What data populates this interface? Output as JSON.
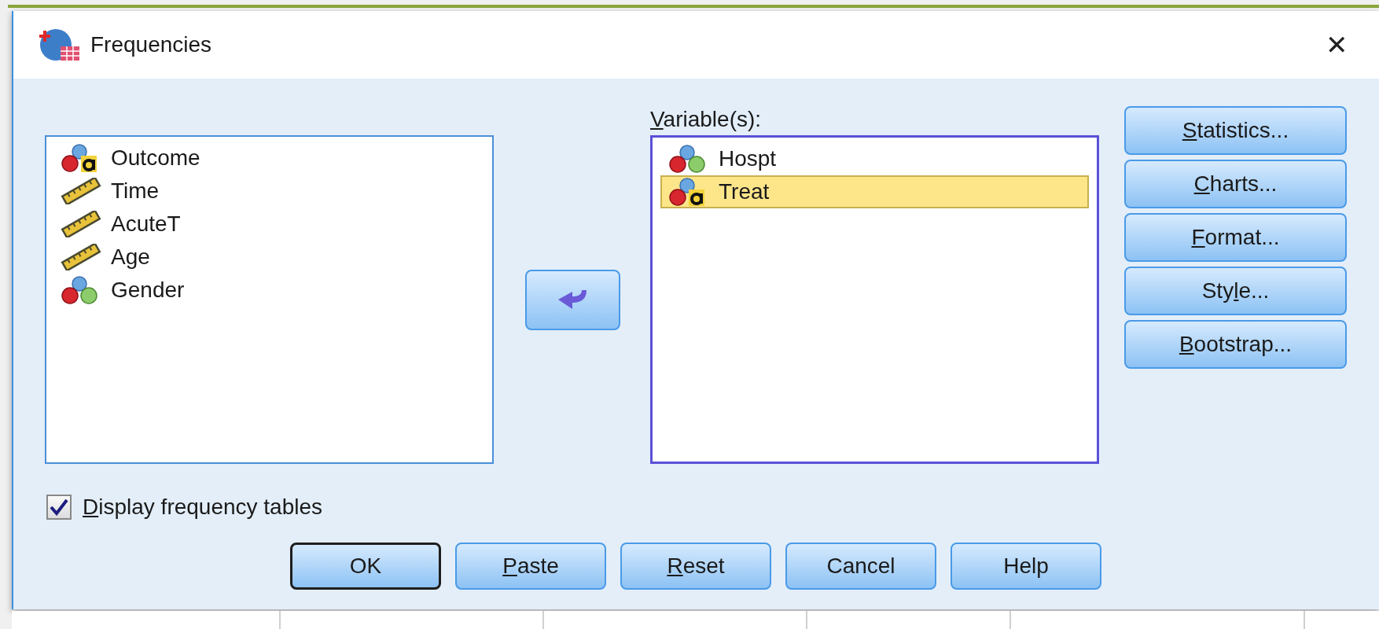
{
  "window": {
    "title": "Frequencies",
    "close": "✕"
  },
  "source_list": {
    "items": [
      {
        "name": "Outcome",
        "kind": "string"
      },
      {
        "name": "Time",
        "kind": "scale"
      },
      {
        "name": "AcuteT",
        "kind": "scale"
      },
      {
        "name": "Age",
        "kind": "scale"
      },
      {
        "name": "Gender",
        "kind": "nominal"
      }
    ]
  },
  "target": {
    "label": {
      "key": "V",
      "after": "ariable(s):"
    },
    "items": [
      {
        "name": "Hospt",
        "kind": "nominal",
        "selected": false
      },
      {
        "name": "Treat",
        "kind": "string",
        "selected": true
      }
    ]
  },
  "side_buttons": [
    {
      "key": "S",
      "after": "tatistics..."
    },
    {
      "key": "C",
      "after": "harts..."
    },
    {
      "key": "F",
      "after": "ormat..."
    },
    {
      "before": "Sty",
      "key": "l",
      "after": "e..."
    },
    {
      "key": "B",
      "after": "ootstrap..."
    }
  ],
  "display_tables": {
    "label": {
      "key": "D",
      "after": "isplay frequency tables"
    },
    "checked": true
  },
  "bottom_buttons": [
    {
      "label": {
        "before": "OK"
      },
      "default": true
    },
    {
      "label": {
        "key": "P",
        "after": "aste"
      },
      "default": false
    },
    {
      "label": {
        "key": "R",
        "after": "eset"
      },
      "default": false
    },
    {
      "label": {
        "before": "Cancel"
      },
      "default": false
    },
    {
      "label": {
        "before": "Help"
      },
      "default": false
    }
  ]
}
